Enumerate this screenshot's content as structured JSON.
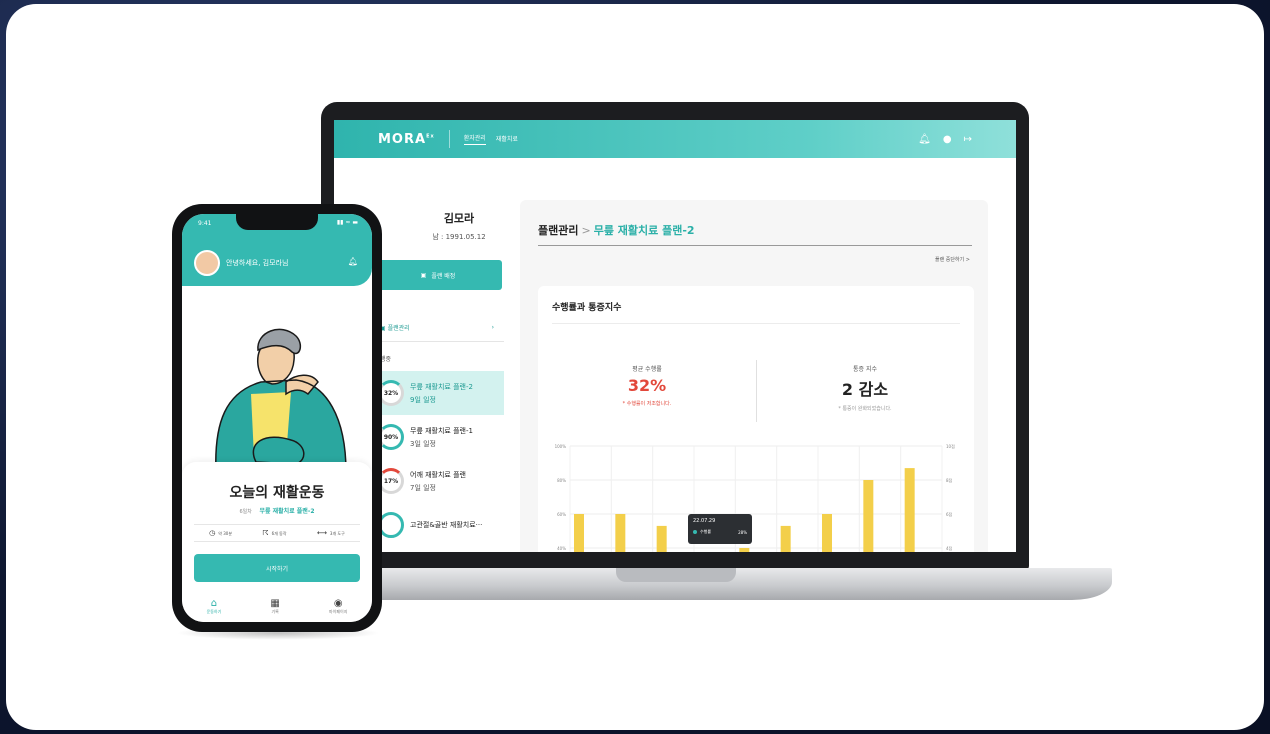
{
  "laptop": {
    "header": {
      "logo": "MORA",
      "logo_sup": "Ex",
      "nav": [
        "환자관리",
        "재활치료"
      ],
      "icons": [
        "bell-icon",
        "user-icon",
        "logout-icon"
      ]
    },
    "sidebar": {
      "user_name": "김모라",
      "user_sub": "남 : 1991.05.12",
      "plan_button": "플랜 배정",
      "plan_mgmt": "플랜관리",
      "section_label": "행중",
      "plans": [
        {
          "percent": "32%",
          "title": "무릎 재활치료 플랜-2",
          "sub": "9일 일정",
          "active": true
        },
        {
          "percent": "90%",
          "title": "무릎 재활치료 플랜-1",
          "sub": "3일 일정",
          "active": false
        },
        {
          "percent": "17%",
          "title": "어깨 재활치료 플랜",
          "sub": "7일 일정",
          "active": false
        },
        {
          "percent": "",
          "title": "고관절&골반 재활치료···",
          "sub": "",
          "active": false
        }
      ]
    },
    "main": {
      "breadcrumb_root": "플랜관리",
      "breadcrumb_sep": ">",
      "breadcrumb_current": "무릎 재활치료 플랜-2",
      "stop_link": "플랜 중단하기  >",
      "stats_title": "수행률과 통증지수",
      "avg_label": "평균 수행률",
      "avg_value": "32%",
      "avg_note": "* 수행률이 저조합니다.",
      "pain_label": "통증 지수",
      "pain_value": "2 감소",
      "pain_note": "* 통증이 완화되었습니다.",
      "tooltip_date": "22.07.29",
      "tooltip_label": "수행률",
      "tooltip_value": "28%"
    }
  },
  "chart_data": {
    "type": "bar",
    "y_ticks_left": [
      "100%",
      "80%",
      "60%",
      "40%"
    ],
    "y_ticks_right": [
      "10점",
      "8점",
      "6점",
      "4점"
    ],
    "ylim": [
      40,
      100
    ],
    "values": [
      60,
      60,
      53,
      null,
      40,
      53,
      60,
      80,
      87
    ],
    "bar_color": "#f3cf4a",
    "accent": "#35b9b1"
  },
  "phone": {
    "status_time": "9:41",
    "status_icons": "▮▮ ≈ ▬",
    "greeting": "안녕하세요, 김모라님",
    "exercise_title": "오늘의 재활운동",
    "exercise_day": "6일차",
    "exercise_plan": "무릎 재활치료 플랜-2",
    "meta": [
      {
        "icon": "clock-icon",
        "glyph": "◷",
        "text": "약 30분"
      },
      {
        "icon": "run-icon",
        "glyph": "☈",
        "text": "6개 동작"
      },
      {
        "icon": "band-icon",
        "glyph": "⟷",
        "text": "3개 도구"
      }
    ],
    "start_button": "시작하기",
    "tabs": [
      {
        "icon": "home-icon",
        "glyph": "⌂",
        "label": "운동하기",
        "active": true
      },
      {
        "icon": "grid-icon",
        "glyph": "▦",
        "label": "기록",
        "active": false
      },
      {
        "icon": "profile-icon",
        "glyph": "◉",
        "label": "마이페이지",
        "active": false
      }
    ]
  },
  "colors": {
    "primary": "#35b9b1",
    "danger": "#e2483b",
    "bar": "#f3cf4a"
  }
}
